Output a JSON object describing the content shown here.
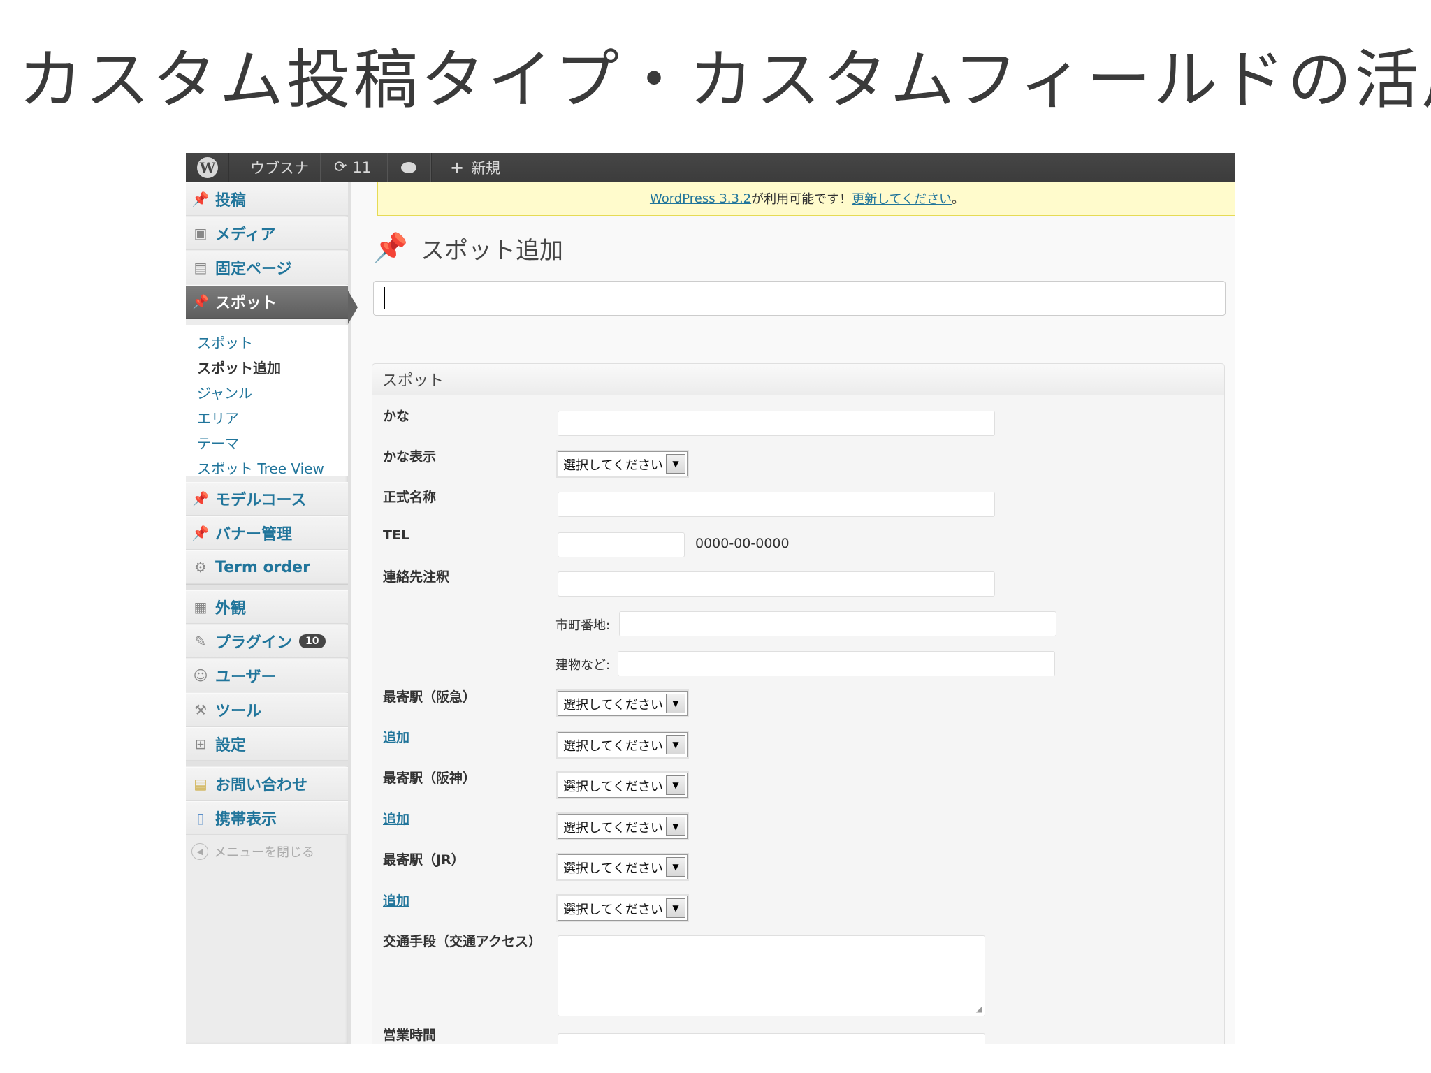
{
  "slide": {
    "title": "カスタム投稿タイプ・カスタムフィールドの活用"
  },
  "adminbar": {
    "logo": "W",
    "site_name": "ウブスナ",
    "updates_icon": "refresh-icon",
    "updates_count": "11",
    "comments_icon": "comment-bubble-icon",
    "new_icon": "plus-icon",
    "new_label": "新規"
  },
  "sidebar": {
    "items": [
      {
        "label": "投稿",
        "icon": "pin-icon"
      },
      {
        "label": "メディア",
        "icon": "media-icon"
      },
      {
        "label": "固定ページ",
        "icon": "pages-icon"
      },
      {
        "label": "スポット",
        "icon": "pin-icon"
      },
      {
        "label": "モデルコース",
        "icon": "pin-icon"
      },
      {
        "label": "バナー管理",
        "icon": "pin-icon"
      },
      {
        "label": "Term order",
        "icon": "gear-icon"
      },
      {
        "label": "外観",
        "icon": "appearance-icon"
      },
      {
        "label": "プラグイン",
        "icon": "plugin-icon",
        "badge": "10"
      },
      {
        "label": "ユーザー",
        "icon": "users-icon"
      },
      {
        "label": "ツール",
        "icon": "tools-icon"
      },
      {
        "label": "設定",
        "icon": "settings-icon"
      },
      {
        "label": "お問い合わせ",
        "icon": "contact-icon"
      },
      {
        "label": "携帯表示",
        "icon": "mobile-icon"
      }
    ],
    "submenu": [
      "スポット",
      "スポット追加",
      "ジャンル",
      "エリア",
      "テーマ",
      "スポット Tree View"
    ],
    "collapse_label": "メニューを閉じる"
  },
  "notice": {
    "link1": "WordPress 3.3.2",
    "text": " が利用可能です！",
    "link2": "更新してください",
    "end": "。"
  },
  "page": {
    "title": "スポット追加",
    "title_input_value": ""
  },
  "metabox": {
    "title": "スポット",
    "fields": {
      "kana": "かな",
      "kana_display": "かな表示",
      "official_name": "正式名称",
      "tel": "TEL",
      "tel_hint": "0000-00-0000",
      "contact_note": "連絡先注釈",
      "address_city": "市町番地:",
      "address_building": "建物など:",
      "station_hankyu": "最寄駅（阪急）",
      "station_hanshin": "最寄駅（阪神）",
      "station_jr": "最寄駅（JR）",
      "add_link": "追加",
      "transport": "交通手段（交通アクセス）",
      "hours": "営業時間"
    },
    "select_placeholder": "選択してください"
  }
}
